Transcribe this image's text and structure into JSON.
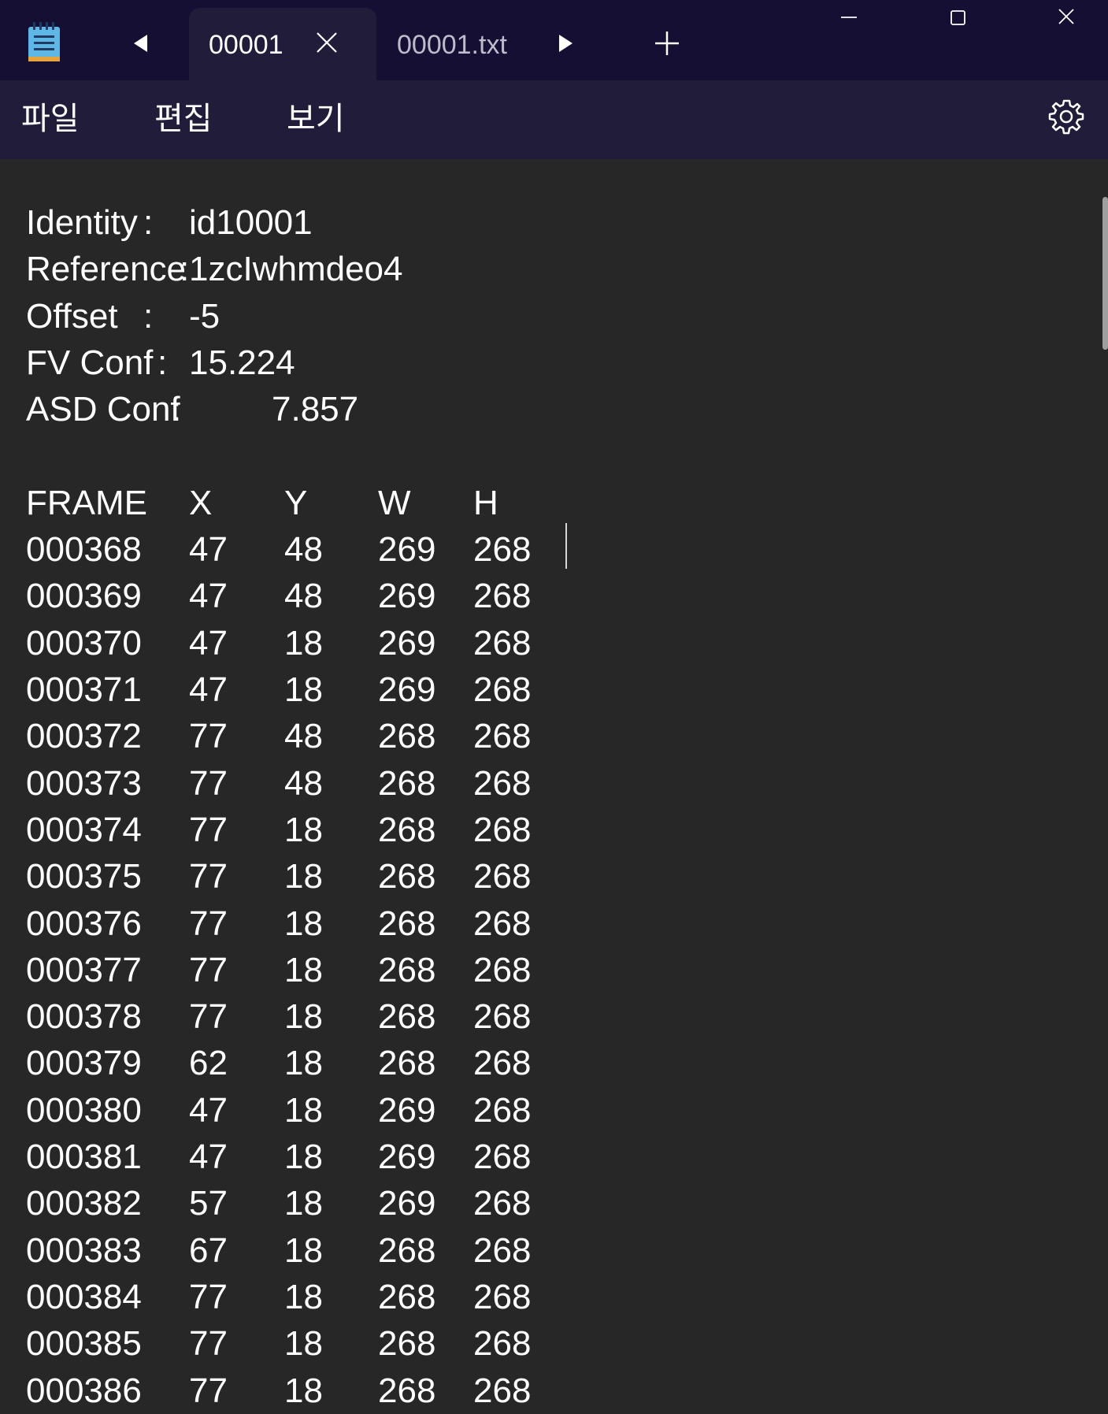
{
  "titlebar": {
    "icon": "notepad-icon",
    "tabs": [
      {
        "label": "00001",
        "active": true
      },
      {
        "label": "00001.txt",
        "active": false
      }
    ]
  },
  "menu": {
    "items": [
      "파일",
      "편집",
      "보기"
    ],
    "settings_icon": "gear-icon"
  },
  "document": {
    "header": [
      {
        "key": "Identity",
        "sep": ":",
        "value": "id10001"
      },
      {
        "key": "Reference",
        "sep": ":",
        "value": "1zcIwhmdeo4"
      },
      {
        "key": "Offset",
        "sep": ":",
        "value": "-5"
      },
      {
        "key": "FV Conf",
        "sep": ":",
        "value": "15.224"
      },
      {
        "key": "ASD Conf",
        "sep": ":",
        "value": "7.857"
      }
    ],
    "table_columns": [
      "FRAME",
      "X",
      "Y",
      "W",
      "H"
    ],
    "table_rows": [
      [
        "000368",
        "47",
        "48",
        "269",
        "268"
      ],
      [
        "000369",
        "47",
        "48",
        "269",
        "268"
      ],
      [
        "000370",
        "47",
        "18",
        "269",
        "268"
      ],
      [
        "000371",
        "47",
        "18",
        "269",
        "268"
      ],
      [
        "000372",
        "77",
        "48",
        "268",
        "268"
      ],
      [
        "000373",
        "77",
        "48",
        "268",
        "268"
      ],
      [
        "000374",
        "77",
        "18",
        "268",
        "268"
      ],
      [
        "000375",
        "77",
        "18",
        "268",
        "268"
      ],
      [
        "000376",
        "77",
        "18",
        "268",
        "268"
      ],
      [
        "000377",
        "77",
        "18",
        "268",
        "268"
      ],
      [
        "000378",
        "77",
        "18",
        "268",
        "268"
      ],
      [
        "000379",
        "62",
        "18",
        "268",
        "268"
      ],
      [
        "000380",
        "47",
        "18",
        "269",
        "268"
      ],
      [
        "000381",
        "47",
        "18",
        "269",
        "268"
      ],
      [
        "000382",
        "57",
        "18",
        "269",
        "268"
      ],
      [
        "000383",
        "67",
        "18",
        "268",
        "268"
      ],
      [
        "000384",
        "77",
        "18",
        "268",
        "268"
      ],
      [
        "000385",
        "77",
        "18",
        "268",
        "268"
      ],
      [
        "000386",
        "77",
        "18",
        "268",
        "268"
      ]
    ]
  },
  "colors": {
    "titlebar": "#140f33",
    "menubar": "#211c3a",
    "editor": "#272727",
    "text": "#ffffff"
  }
}
